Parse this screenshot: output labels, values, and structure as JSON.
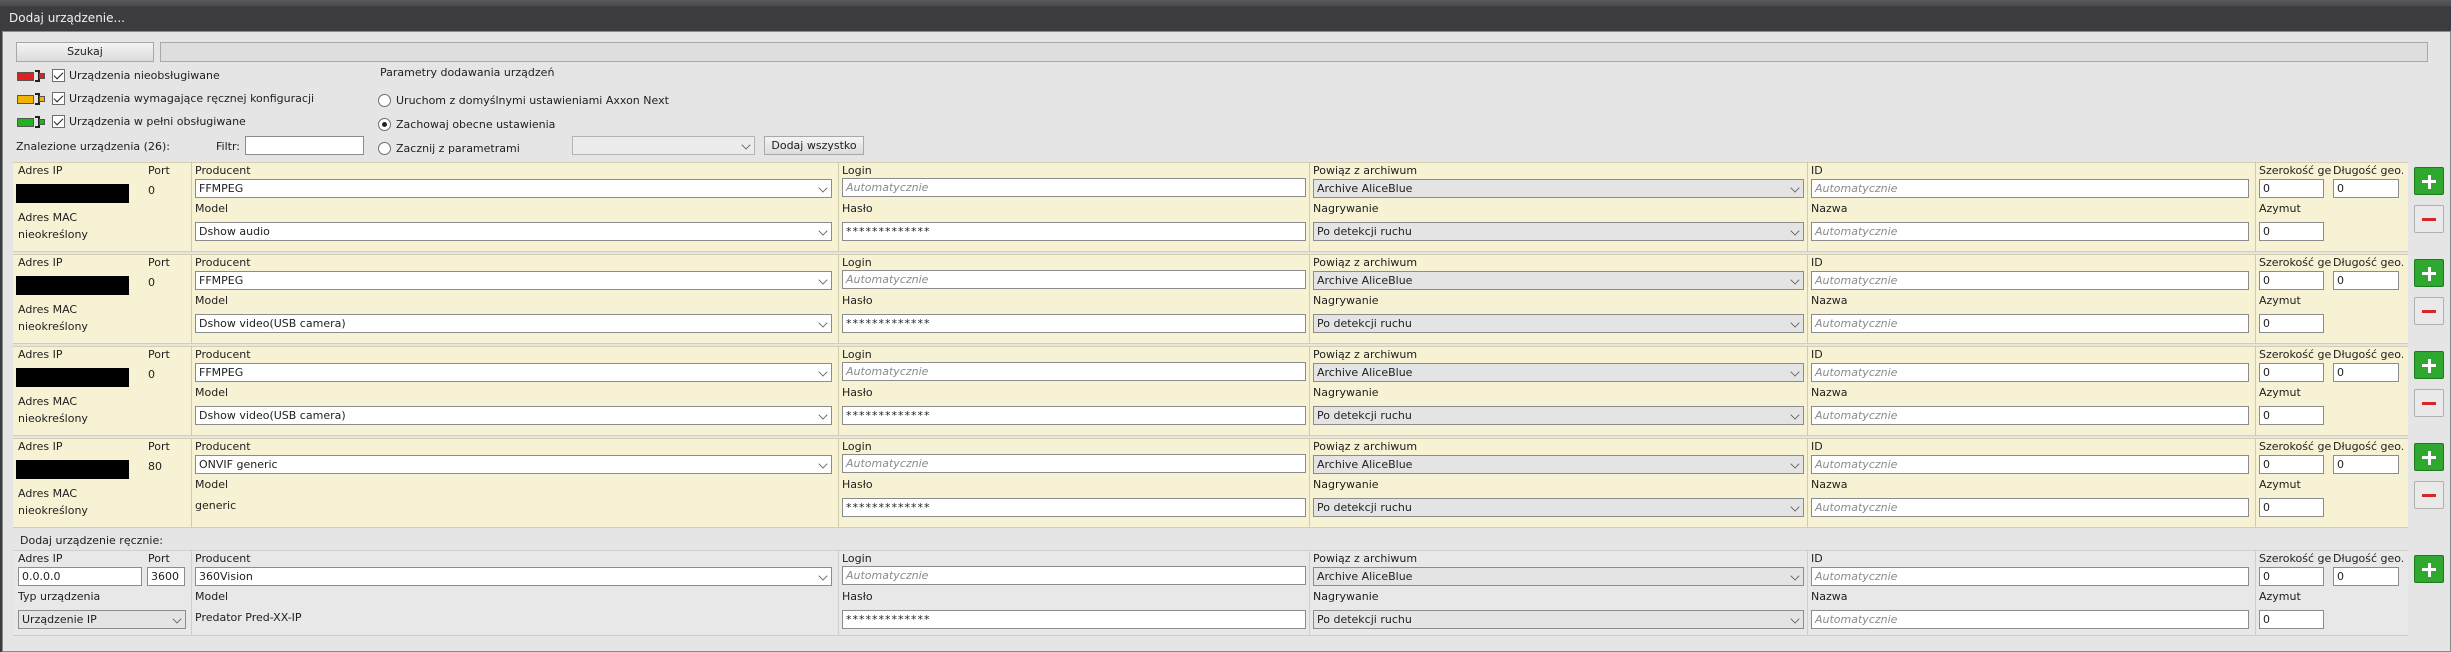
{
  "window": {
    "title": "Dodaj urządzenie..."
  },
  "toolbar": {
    "search_label": "Szukaj"
  },
  "legend": [
    {
      "label": "Urządzenia nieobsługiwane",
      "color": "#e02020",
      "checked": true
    },
    {
      "label": "Urządzenia wymagające ręcznej konfiguracji",
      "color": "#f0b400",
      "checked": true
    },
    {
      "label": "Urządzenia w pełni obsługiwane",
      "color": "#1eb41e",
      "checked": true
    }
  ],
  "params": {
    "title": "Parametry dodawania urządzeń",
    "options": [
      {
        "label": "Uruchom z domyślnymi ustawieniami Axxon Next",
        "selected": false
      },
      {
        "label": "Zachowaj obecne ustawienia",
        "selected": true
      },
      {
        "label": "Zacznij z parametrami",
        "selected": false
      }
    ],
    "add_all_label": "Dodaj wszystko"
  },
  "found": {
    "label": "Znalezione urządzenia (26):",
    "filter_label": "Filtr:",
    "filter_value": ""
  },
  "labels": {
    "ip": "Adres IP",
    "port": "Port",
    "mac": "Adres MAC",
    "producer": "Producent",
    "model": "Model",
    "login": "Login",
    "password": "Hasło",
    "archive": "Powiąz z archiwum",
    "recording": "Nagrywanie",
    "id": "ID",
    "name": "Nazwa",
    "lat": "Szerokość geo.",
    "lon": "Długość geo.",
    "azimuth": "Azymut",
    "auto": "Automatycznie",
    "device_type": "Typ urządzenia"
  },
  "devices": [
    {
      "port": "0",
      "mac": "nieokreślony",
      "producer": "FFMPEG",
      "model": "Dshow audio",
      "model_editable": true,
      "login": "",
      "password": "*************",
      "archive": "Archive AliceBlue",
      "recording": "Po detekcji ruchu",
      "id": "",
      "name": "",
      "lat": "0",
      "lon": "0",
      "azimuth": "0"
    },
    {
      "port": "0",
      "mac": "nieokreślony",
      "producer": "FFMPEG",
      "model": "Dshow video(USB camera)",
      "model_editable": true,
      "login": "",
      "password": "*************",
      "archive": "Archive AliceBlue",
      "recording": "Po detekcji ruchu",
      "id": "",
      "name": "",
      "lat": "0",
      "lon": "0",
      "azimuth": "0"
    },
    {
      "port": "0",
      "mac": "nieokreślony",
      "producer": "FFMPEG",
      "model": "Dshow video(USB camera)",
      "model_editable": true,
      "login": "",
      "password": "*************",
      "archive": "Archive AliceBlue",
      "recording": "Po detekcji ruchu",
      "id": "",
      "name": "",
      "lat": "0",
      "lon": "0",
      "azimuth": "0"
    },
    {
      "port": "80",
      "mac": "nieokreślony",
      "producer": "ONVIF generic",
      "model": "generic",
      "model_editable": false,
      "login": "",
      "password": "*************",
      "archive": "Archive AliceBlue",
      "recording": "Po detekcji ruchu",
      "id": "",
      "name": "",
      "lat": "0",
      "lon": "0",
      "azimuth": "0"
    }
  ],
  "manual": {
    "title": "Dodaj urządzenie ręcznie:",
    "ip": "0.0.0.0",
    "port": "3600",
    "device_type": "Urządzenie IP",
    "producer": "360Vision",
    "model": "Predator Pred-XX-IP",
    "login": "",
    "password": "*************",
    "archive": "Archive AliceBlue",
    "recording": "Po detekcji ruchu",
    "id": "",
    "name": "",
    "lat": "0",
    "lon": "0",
    "azimuth": "0"
  }
}
